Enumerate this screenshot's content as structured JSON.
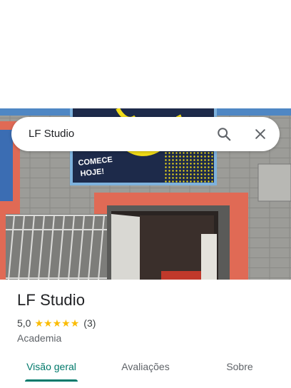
{
  "search": {
    "query": "LF Studio"
  },
  "icons": {
    "search": "search-icon",
    "close": "close-icon",
    "star": "star-icon"
  },
  "photo": {
    "sign_text_line1": "COMECE",
    "sign_text_line2": "HOJE!"
  },
  "place": {
    "name": "LF Studio",
    "rating": "5,0",
    "stars": 5,
    "review_count": "(3)",
    "category": "Academia"
  },
  "tabs": [
    {
      "label": "Visão geral",
      "active": true
    },
    {
      "label": "Avaliações",
      "active": false
    },
    {
      "label": "Sobre",
      "active": false
    }
  ],
  "colors": {
    "accent": "#00796b",
    "star": "#fbbc04",
    "wall": "#9a9a96",
    "trim": "#e06a55",
    "sign": "#1d2a4a",
    "sign_yellow": "#f2dc17"
  }
}
